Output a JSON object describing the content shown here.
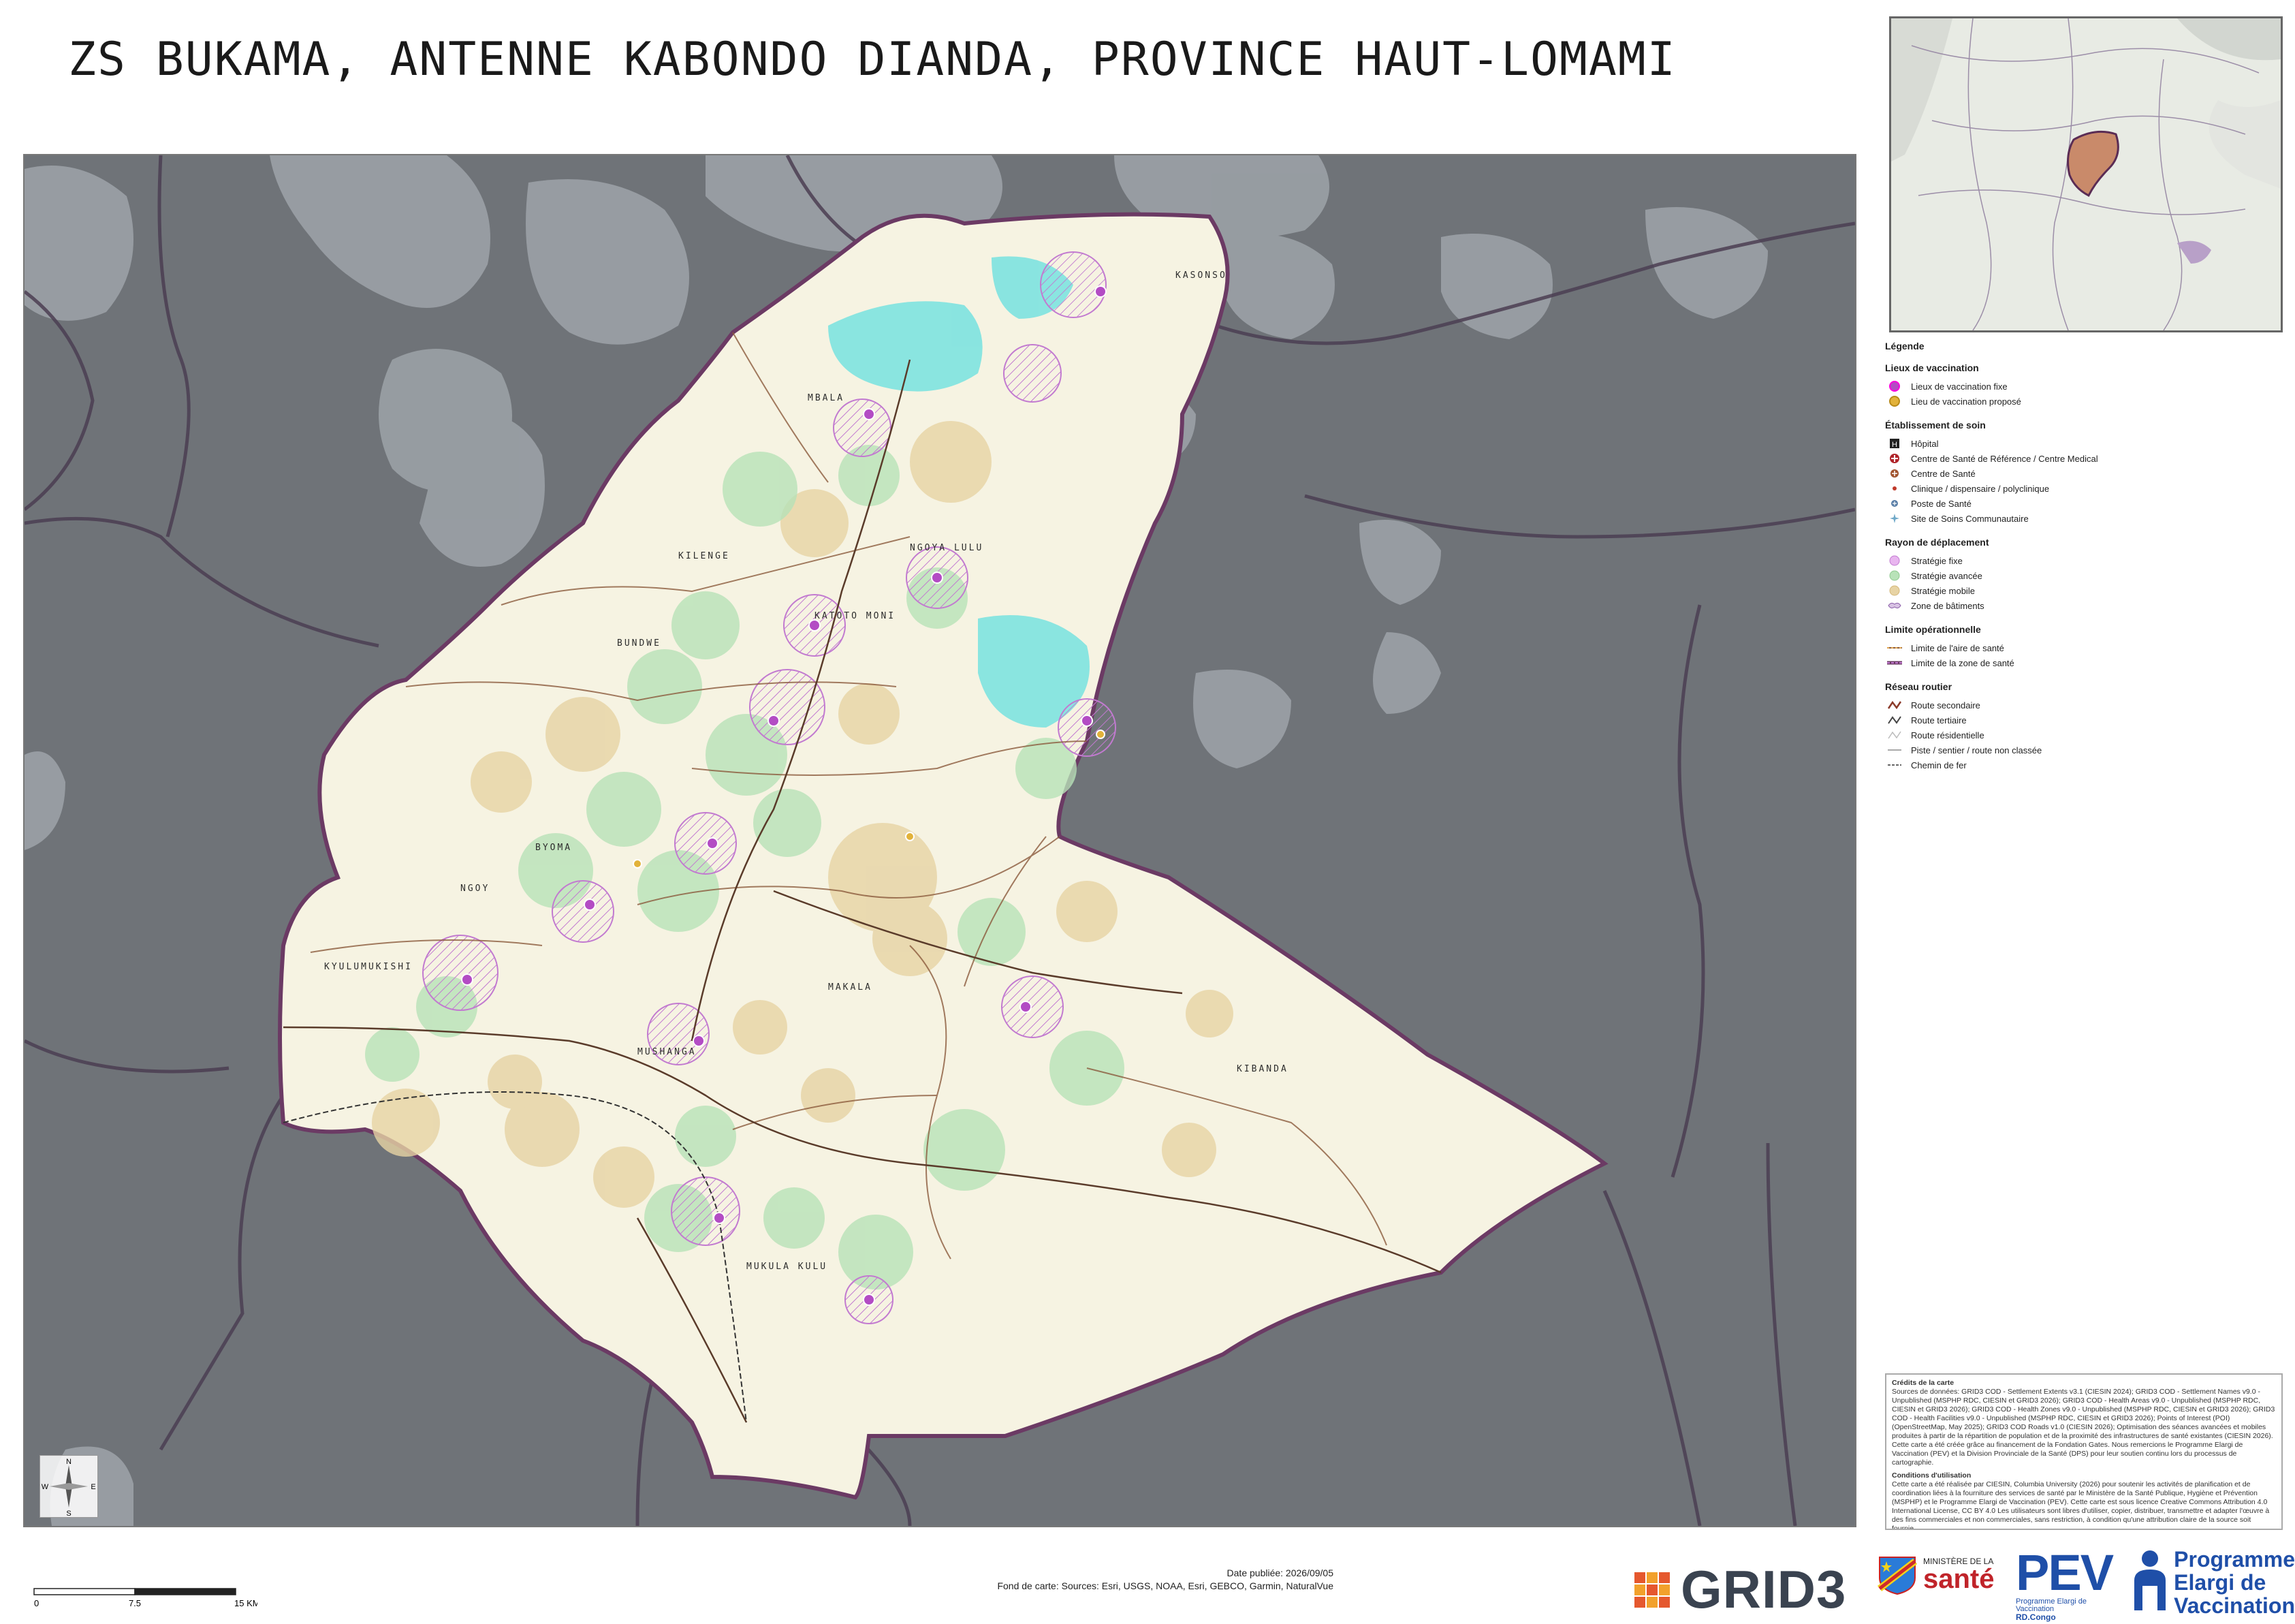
{
  "title": "ZS BUKAMA, ANTENNE KABONDO DIANDA, PROVINCE HAUT-LOMAMI",
  "map": {
    "area_labels": [
      "MBALA",
      "KILENGE",
      "BUNDWE",
      "BYOMA",
      "NGOY",
      "KYULUMUKISHI",
      "MUSHANGA",
      "MAKALA",
      "MUKULA KULU",
      "KIBANDA",
      "KATOTO MONI",
      "NGOYA LULU",
      "KASONSO"
    ],
    "colors": {
      "outside": "#6f7378",
      "outside_settlement": "#9aa0a5",
      "zone_fill": "#f6f3e2",
      "zone_border": "#6b3a64",
      "fixed": "#dd9be7",
      "advanced": "#b8e2b8",
      "mobile": "#e7d3a4",
      "building_zone": "#7ee3e0"
    }
  },
  "legend": {
    "title": "Légende",
    "sections": [
      {
        "heading": "Lieux de vaccination",
        "items": [
          {
            "icon": "fixed-site-icon",
            "label": "Lieux de vaccination fixe"
          },
          {
            "icon": "proposed-site-icon",
            "label": "Lieu de vaccination proposé"
          }
        ]
      },
      {
        "heading": "Établissement de soin",
        "items": [
          {
            "icon": "hospital-icon",
            "label": "Hôpital"
          },
          {
            "icon": "reference-center-icon",
            "label": "Centre de Santé de Référence / Centre Medical"
          },
          {
            "icon": "health-center-icon",
            "label": "Centre de Santé"
          },
          {
            "icon": "clinic-icon",
            "label": "Clinique / dispensaire / polyclinique"
          },
          {
            "icon": "health-post-icon",
            "label": "Poste de Santé"
          },
          {
            "icon": "community-care-icon",
            "label": "Site de Soins Communautaire"
          }
        ]
      },
      {
        "heading": "Rayon de déplacement",
        "items": [
          {
            "icon": "fixed-strategy-icon",
            "label": "Stratégie fixe"
          },
          {
            "icon": "advanced-strategy-icon",
            "label": "Stratégie avancée"
          },
          {
            "icon": "mobile-strategy-icon",
            "label": "Stratégie mobile"
          },
          {
            "icon": "building-zone-icon",
            "label": "Zone de bâtiments"
          }
        ]
      },
      {
        "heading": "Limite opérationnelle",
        "items": [
          {
            "icon": "health-area-limit-icon",
            "label": "Limite de l'aire de santé"
          },
          {
            "icon": "health-zone-limit-icon",
            "label": "Limite de la zone de santé"
          }
        ]
      },
      {
        "heading": "Réseau routier",
        "items": [
          {
            "icon": "secondary-road-icon",
            "label": "Route secondaire"
          },
          {
            "icon": "tertiary-road-icon",
            "label": "Route tertiaire"
          },
          {
            "icon": "residential-road-icon",
            "label": "Route résidentielle"
          },
          {
            "icon": "track-icon",
            "label": "Piste / sentier / route non classée"
          },
          {
            "icon": "railway-icon",
            "label": "Chemin de fer"
          }
        ]
      }
    ]
  },
  "credits": {
    "heading": "Crédits de la carte",
    "text": "Sources de données: GRID3 COD - Settlement Extents v3.1 (CIESIN 2024); GRID3 COD - Settlement Names v9.0 - Unpublished (MSPHP RDC, CIESIN et GRID3 2026); GRID3 COD - Health Areas v9.0 - Unpublished (MSPHP RDC, CIESIN et GRID3 2026); GRID3 COD - Health Zones v9.0 - Unpublished (MSPHP RDC, CIESIN et GRID3 2026); GRID3 COD - Health Facilities v9.0 - Unpublished (MSPHP RDC, CIESIN et GRID3 2026); Points of Interest (POI) (OpenStreetMap, May 2025); GRID3 COD Roads v1.0 (CIESIN 2026); Optimisation des séances avancées et mobiles produites à partir de la répartition de population et de la proximité des infrastructures de santé existantes (CIESIN 2026). Cette carte a été créée grâce au financement de la Fondation Gates. Nous remercions le Programme Elargi de Vaccination (PEV) et la Division Provinciale de la Santé (DPS) pour leur soutien continu lors du processus de cartographie.",
    "conditions_heading": "Conditions d'utilisation",
    "conditions": "Cette carte a été réalisée par CIESIN, Columbia University (2026) pour soutenir les activités de planification et de coordination liées à la fourniture des services de santé par le Ministère de la Santé Publique, Hygiène et Prévention (MSPHP) et le Programme Elargi de Vaccination (PEV). Cette carte est sous licence Creative Commons Attribution 4.0 International License, CC BY 4.0 Les utilisateurs sont libres d'utiliser, copier, distribuer, transmettre et adapter l'œuvre à des fins commerciales et non commerciales, sans restriction, à condition qu'une attribution claire de la source soit fournie."
  },
  "footer": {
    "date_published": "Date publiée: 2026/09/05",
    "basemap": "Fond de carte: Sources: Esri, USGS, NOAA, Esri, GEBCO, Garmin, NaturalVue",
    "scale_ticks": [
      "0",
      "7.5",
      "15 KM"
    ],
    "grid3": "GRID3",
    "ministry_small": "MINISTÈRE DE LA",
    "ministry_big": "santé",
    "pev": "PEV",
    "pev_sub1": "Programme Elargi de Vaccination",
    "pev_sub2": "RD.Congo",
    "programme": [
      "Programme",
      "Elargi de",
      "Vaccination"
    ],
    "compass": {
      "n": "N",
      "s": "S",
      "e": "E",
      "w": "W"
    }
  }
}
